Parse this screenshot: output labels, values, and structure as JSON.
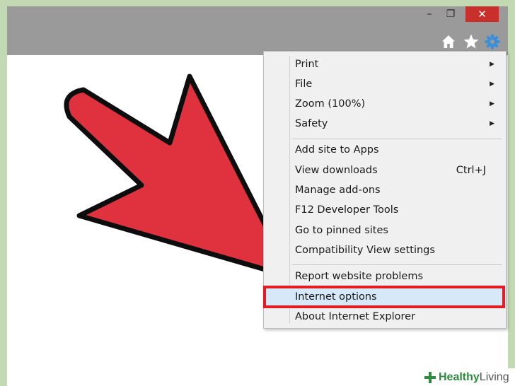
{
  "window": {
    "controls": {
      "minimize": "–",
      "restore": "❐",
      "close": "✕"
    },
    "toolbar_icons": [
      "home-icon",
      "star-icon",
      "gear-icon"
    ],
    "icon_color": "#ffffff",
    "accent_gear": "#3b8fd9"
  },
  "menu": {
    "items": [
      {
        "label": "Print",
        "submenu": true
      },
      {
        "label": "File",
        "submenu": true
      },
      {
        "label": "Zoom (100%)",
        "submenu": true
      },
      {
        "label": "Safety",
        "submenu": true
      },
      {
        "label": "Add site to Apps"
      },
      {
        "label": "View downloads",
        "shortcut": "Ctrl+J"
      },
      {
        "label": "Manage add-ons"
      },
      {
        "label": "F12 Developer Tools"
      },
      {
        "label": "Go to pinned sites"
      },
      {
        "label": "Compatibility View settings"
      },
      {
        "label": "Report website problems"
      },
      {
        "label": "Internet options",
        "highlighted": true
      },
      {
        "label": "About Internet Explorer"
      }
    ],
    "submenu_glyph": "▶",
    "highlight_color": "#e11d23"
  },
  "annotation": {
    "arrow_color": "#e0313f"
  },
  "watermark": {
    "word1": "Healthy",
    "word2": "Living"
  }
}
